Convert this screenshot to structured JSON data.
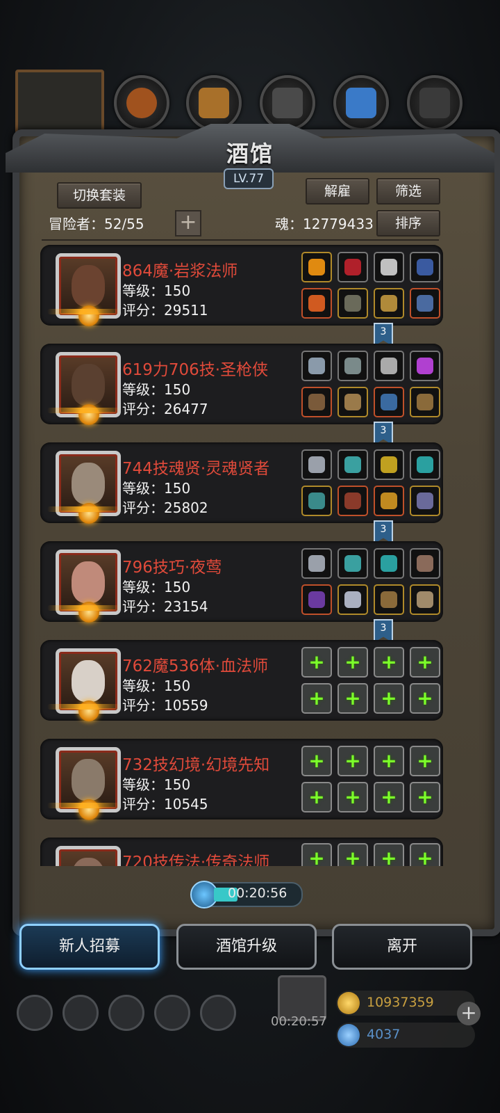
{
  "title": "酒馆",
  "level": "LV.77",
  "buttons": {
    "switch_outfit": "切换套装",
    "dismiss": "解雇",
    "filter": "筛选",
    "sort": "排序"
  },
  "stats": {
    "adventurers_label": "冒险者：52/55",
    "soul_label": "魂：12779433"
  },
  "heroes": [
    {
      "name": "864魔·岩浆法师",
      "level": "等级：150",
      "score": "评分：29511",
      "tag": "3"
    },
    {
      "name": "619力706技·圣枪侠",
      "level": "等级：150",
      "score": "评分：26477",
      "tag": "3"
    },
    {
      "name": "744技魂贤·灵魂贤者",
      "level": "等级：150",
      "score": "评分：25802",
      "tag": "3"
    },
    {
      "name": "796技巧·夜莺",
      "level": "等级：150",
      "score": "评分：23154",
      "tag": "3"
    },
    {
      "name": "762魔536体·血法师",
      "level": "等级：150",
      "score": "评分：10559",
      "tag": ""
    },
    {
      "name": "732技幻境·幻境先知",
      "level": "等级：150",
      "score": "评分：10545",
      "tag": ""
    },
    {
      "name": "720技传法·传奇法师",
      "level": "",
      "score": "",
      "tag": ""
    }
  ],
  "timer": "00:20:56",
  "bottom_buttons": {
    "recruit": "新人招募",
    "upgrade": "酒馆升级",
    "leave": "离开"
  },
  "gift_timer": "00:20:57",
  "resources": {
    "gold": "10937359",
    "gems": "4037"
  },
  "colors": {
    "hero_name": "#e04a3a",
    "accent_blue": "#3aa0ff",
    "plus_green": "#7cff2a"
  }
}
